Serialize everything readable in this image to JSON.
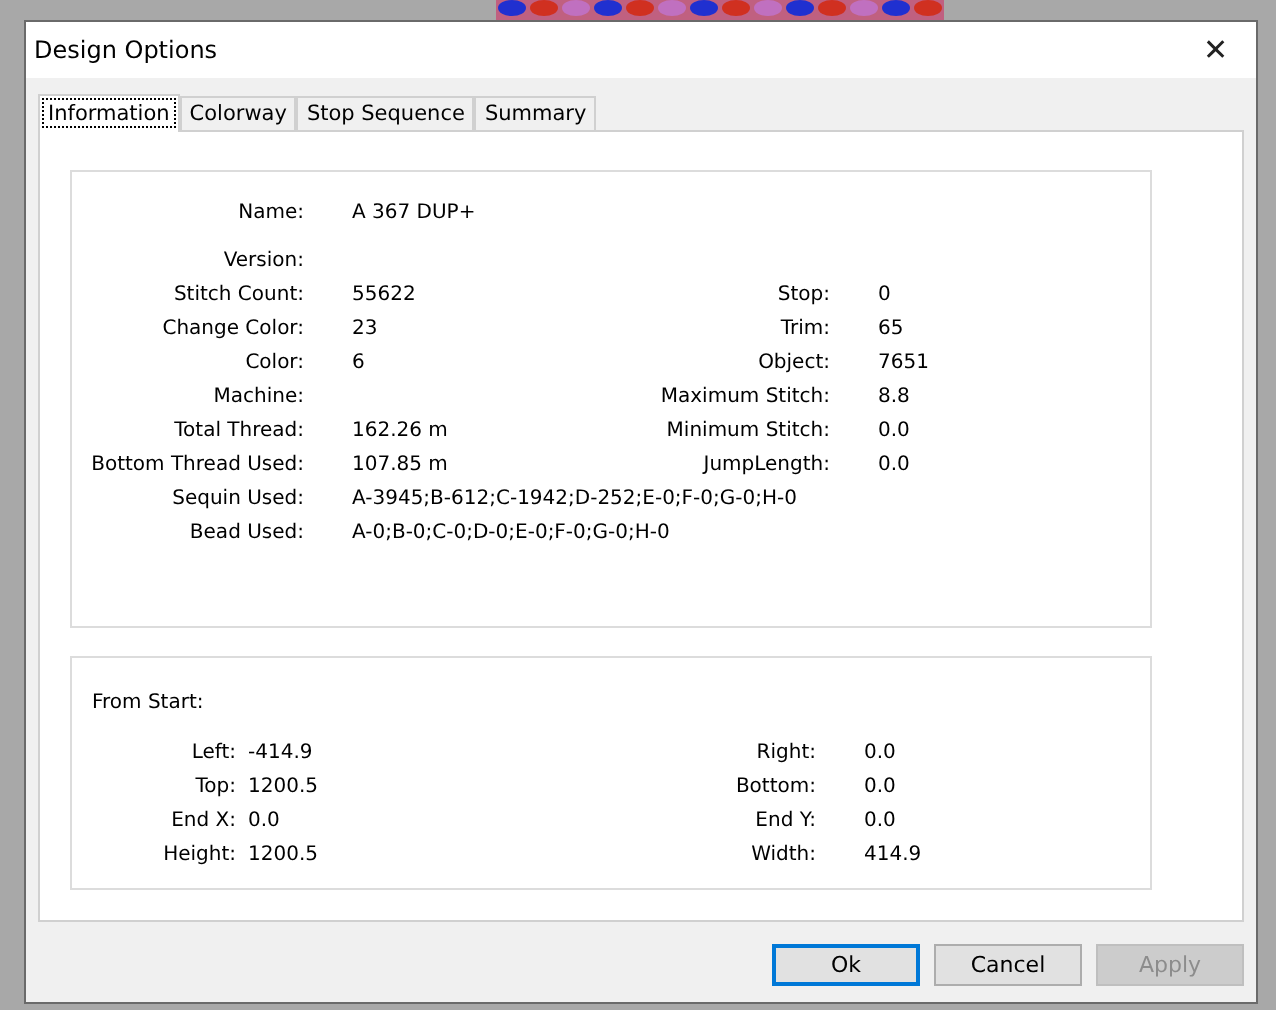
{
  "window": {
    "title": "Design Options",
    "close": "✕"
  },
  "tabs": [
    {
      "label": "Information",
      "selected": true
    },
    {
      "label": "Colorway",
      "selected": false
    },
    {
      "label": "Stop Sequence",
      "selected": false
    },
    {
      "label": "Summary",
      "selected": false
    }
  ],
  "information": {
    "rows": [
      {
        "label": "Name:",
        "value": "A 367 DUP+"
      },
      {
        "label": "Version:"
      },
      {
        "label": "Stitch Count:",
        "value": "55622",
        "right_label": "Stop:",
        "right_value": "0"
      },
      {
        "label": "Change Color:",
        "value": "23",
        "right_label": "Trim:",
        "right_value": "65"
      },
      {
        "label": "Color:",
        "value": "6",
        "right_label": "Object:",
        "right_value": "7651"
      },
      {
        "label": "Machine:",
        "right_label": "Maximum Stitch:",
        "right_value": "8.8"
      },
      {
        "label": "Total Thread:",
        "value": "162.26 m",
        "right_label": "Minimum Stitch:",
        "right_value": "0.0"
      },
      {
        "label": "Bottom Thread Used:",
        "value": "107.85 m",
        "right_label": "JumpLength:",
        "right_value": "0.0"
      },
      {
        "label": "Sequin Used:",
        "value": "A-3945;B-612;C-1942;D-252;E-0;F-0;G-0;H-0"
      },
      {
        "label": "Bead Used:",
        "value": "A-0;B-0;C-0;D-0;E-0;F-0;G-0;H-0"
      }
    ]
  },
  "from_start": {
    "title": "From Start:",
    "rows": [
      {
        "label": "Left:",
        "value": "-414.9",
        "right_label": "Right:",
        "right_value": "0.0"
      },
      {
        "label": "Top:",
        "value": "1200.5",
        "right_label": "Bottom:",
        "right_value": "0.0"
      },
      {
        "label": "End X:",
        "value": "0.0",
        "right_label": "End Y:",
        "right_value": "0.0"
      },
      {
        "label": "Height:",
        "value": "1200.5",
        "right_label": "Width:",
        "right_value": "414.9"
      }
    ]
  },
  "buttons": [
    {
      "label": "Ok",
      "default": true,
      "disabled": false
    },
    {
      "label": "Cancel",
      "default": false,
      "disabled": false
    },
    {
      "label": "Apply",
      "default": false,
      "disabled": true
    }
  ]
}
